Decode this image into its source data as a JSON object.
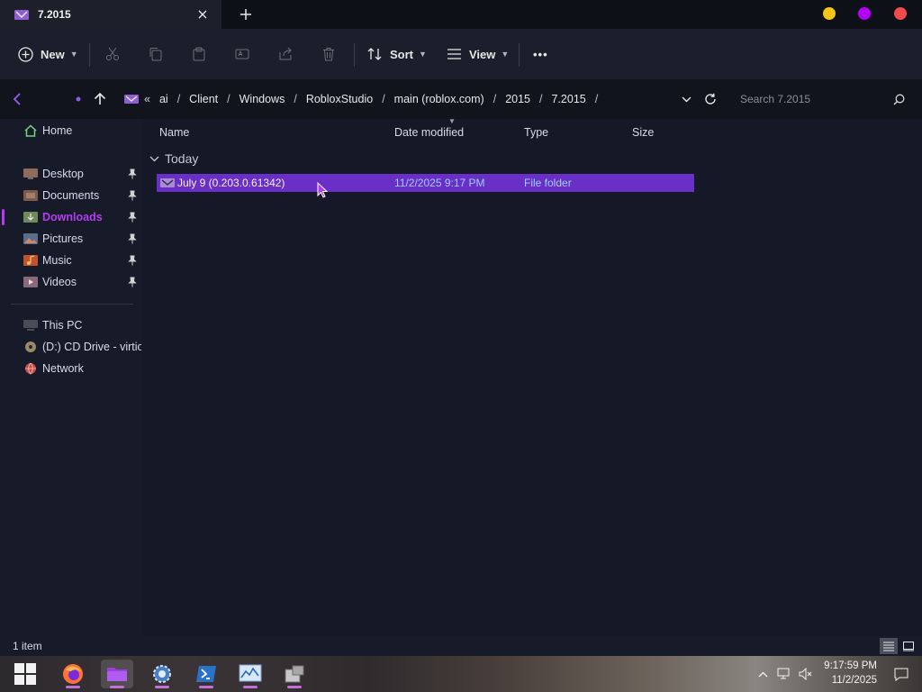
{
  "window": {
    "tab_title": "7.2015",
    "colors": {
      "accent": "#b43cf0",
      "selection": "#6a2fc7",
      "minimize_dot": "#f5c518",
      "maximize_dot": "#b400f5",
      "close_dot": "#f04a4a"
    }
  },
  "toolbar": {
    "new_label": "New",
    "sort_label": "Sort",
    "view_label": "View",
    "more_label": "•••",
    "icons": [
      "plus-circle-icon",
      "cut-icon",
      "copy-icon",
      "paste-icon",
      "rename-icon",
      "share-icon",
      "delete-icon",
      "sort-icon",
      "view-icon"
    ]
  },
  "address": {
    "lead": "«",
    "breadcrumbs": [
      "ai",
      "Client",
      "Windows",
      "RobloxStudio",
      "main (roblox.com)",
      "2015",
      "7.2015"
    ],
    "search_placeholder": "Search 7.2015"
  },
  "sidebar": {
    "home": {
      "label": "Home",
      "icon": "home-icon"
    },
    "quick_access": [
      {
        "label": "Desktop",
        "icon": "desktop-icon",
        "pinned": true
      },
      {
        "label": "Documents",
        "icon": "documents-icon",
        "pinned": true
      },
      {
        "label": "Downloads",
        "icon": "downloads-icon",
        "pinned": true,
        "active": true
      },
      {
        "label": "Pictures",
        "icon": "pictures-icon",
        "pinned": true
      },
      {
        "label": "Music",
        "icon": "music-icon",
        "pinned": true
      },
      {
        "label": "Videos",
        "icon": "videos-icon",
        "pinned": true
      }
    ],
    "devices": [
      {
        "label": "This PC",
        "icon": "pc-icon"
      },
      {
        "label": "(D:) CD Drive - virtio-",
        "icon": "cd-drive-icon"
      },
      {
        "label": "Network",
        "icon": "network-icon"
      }
    ]
  },
  "content": {
    "columns": {
      "name": "Name",
      "date": "Date modified",
      "type": "Type",
      "size": "Size"
    },
    "group": "Today",
    "rows": [
      {
        "name": "July 9 (0.203.0.61342)",
        "date": "11/2/2025 9:17 PM",
        "type": "File folder",
        "size": "",
        "selected": true
      }
    ]
  },
  "status": {
    "item_count": "1 item"
  },
  "taskbar": {
    "apps": [
      "start-icon",
      "firefox-icon",
      "file-explorer-icon",
      "settings-icon",
      "powershell-icon",
      "resource-monitor-icon",
      "app-icon"
    ],
    "time": "9:17:59 PM",
    "date": "11/2/2025"
  }
}
